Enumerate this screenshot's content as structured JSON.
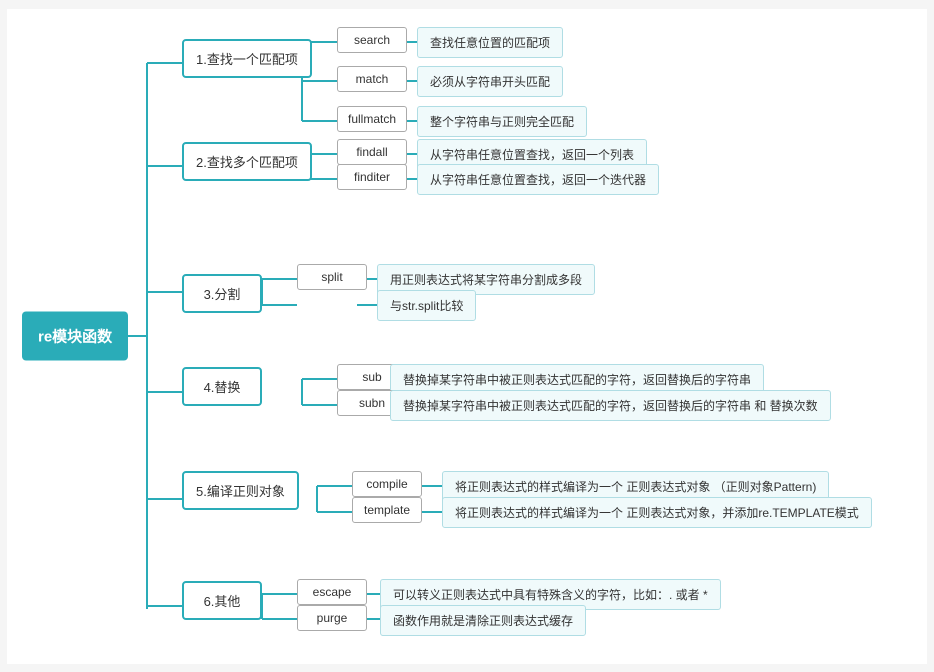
{
  "root": {
    "label": "re模块函数"
  },
  "categories": [
    {
      "id": "cat1",
      "label": "1.查找一个匹配项",
      "children": [
        {
          "id": "search",
          "label": "search",
          "desc": "查找任意位置的匹配项"
        },
        {
          "id": "match",
          "label": "match",
          "desc": "必须从字符串开头匹配"
        },
        {
          "id": "fullmatch",
          "label": "fullmatch",
          "desc": "整个字符串与正则完全匹配"
        }
      ]
    },
    {
      "id": "cat2",
      "label": "2.查找多个匹配项",
      "children": [
        {
          "id": "findall",
          "label": "findall",
          "desc": "从字符串任意位置查找，返回一个列表"
        },
        {
          "id": "finditer",
          "label": "finditer",
          "desc": "从字符串任意位置查找，返回一个迭代器"
        }
      ]
    },
    {
      "id": "cat3",
      "label": "3.分割",
      "children": [
        {
          "id": "split",
          "label": "split",
          "descs": [
            "用正则表达式将某字符串分割成多段",
            "与str.split比较"
          ]
        }
      ]
    },
    {
      "id": "cat4",
      "label": "4.替换",
      "children": [
        {
          "id": "sub",
          "label": "sub",
          "desc": "替换掉某字符串中被正则表达式匹配的字符，返回替换后的字符串"
        },
        {
          "id": "subn",
          "label": "subn",
          "desc": "替换掉某字符串中被正则表达式匹配的字符，返回替换后的字符串 和 替换次数"
        }
      ]
    },
    {
      "id": "cat5",
      "label": "5.编译正则对象",
      "children": [
        {
          "id": "compile",
          "label": "compile",
          "desc": "将正则表达式的样式编译为一个 正则表达式对象  （正则对象Pattern)"
        },
        {
          "id": "template",
          "label": "template",
          "desc": "将正则表达式的样式编译为一个 正则表达式对象，并添加re.TEMPLATE模式"
        }
      ]
    },
    {
      "id": "cat6",
      "label": "6.其他",
      "children": [
        {
          "id": "escape",
          "label": "escape",
          "desc": "可以转义正则表达式中具有特殊含义的字符，比如：.  或者  *"
        },
        {
          "id": "purge",
          "label": "purge",
          "desc": "函数作用就是清除正则表达式缓存"
        }
      ]
    }
  ]
}
